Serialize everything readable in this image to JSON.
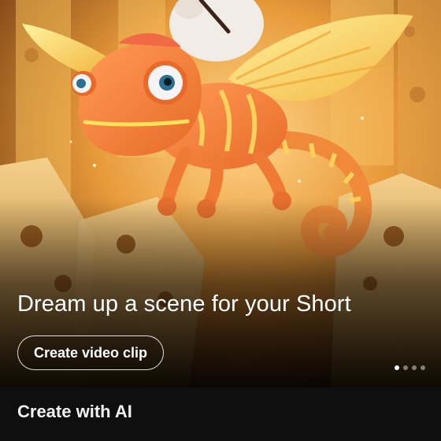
{
  "hero": {
    "headline": "Dream up a scene for your Short",
    "cta_label": "Create video clip",
    "carousel": {
      "total": 4,
      "active_index": 0
    }
  },
  "section": {
    "title": "Create with AI"
  },
  "colors": {
    "background": "#0f0f0f",
    "text": "#ffffff",
    "chameleon": "#f28a3c",
    "wing": "#f5c84a",
    "sky": "#f2a03a"
  },
  "icons": [
    "chameleon-illustration"
  ]
}
